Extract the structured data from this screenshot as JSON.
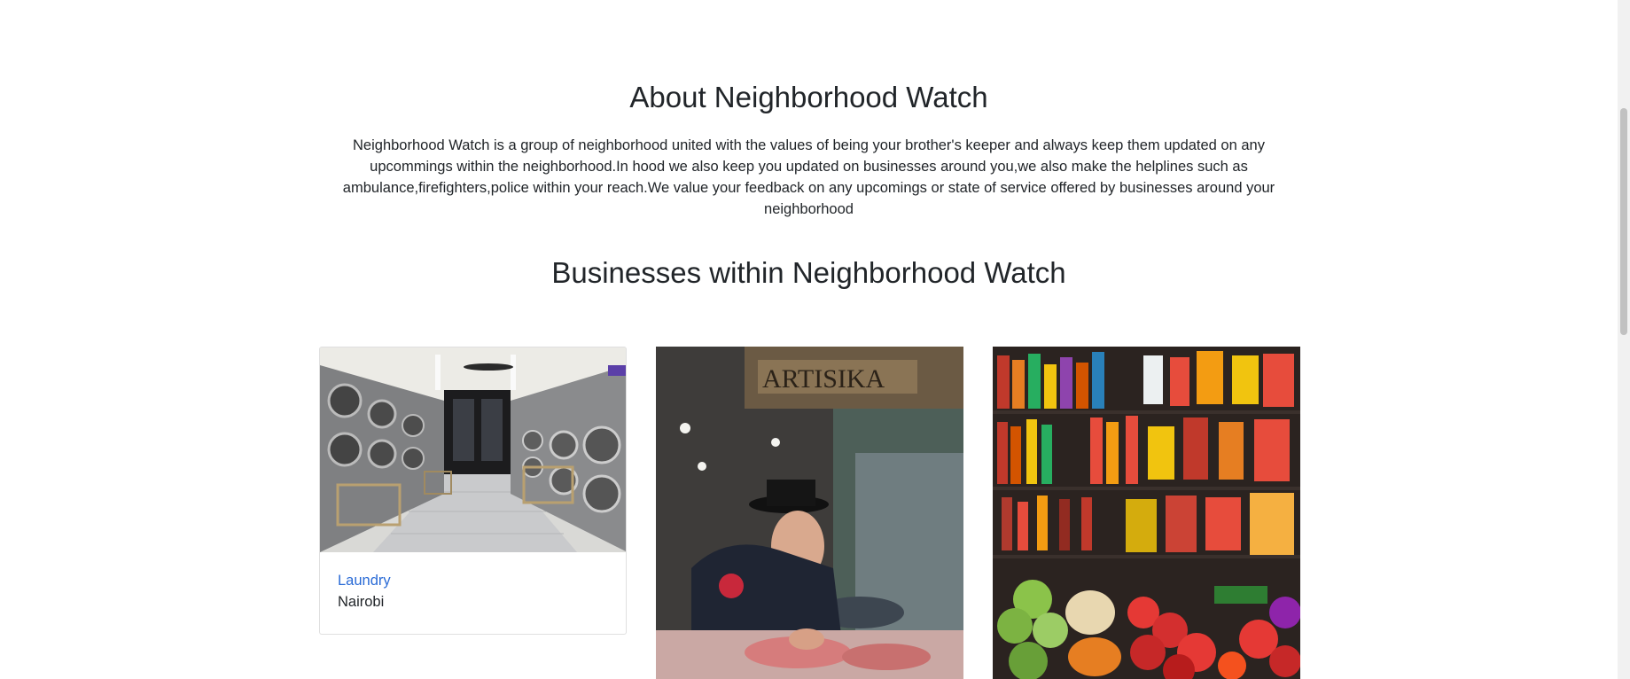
{
  "about": {
    "title": "About Neighborhood Watch",
    "text": "Neighborhood Watch is a group of neighborhood united with the values of being your brother's keeper and always keep them updated on any upcommings within the neighborhood.In hood we also keep you updated on businesses around you,we also make the helplines such as ambulance,firefighters,police within your reach.We value your feedback on any upcomings or state of service offered by businesses around your neighborhood"
  },
  "businesses": {
    "title": "Businesses within Neighborhood Watch",
    "cards": [
      {
        "name": "Laundry",
        "location": "Nairobi",
        "image_icon": "laundromat-photo"
      },
      {
        "name": "",
        "location": "",
        "image_icon": "butcher-photo"
      },
      {
        "name": "",
        "location": "",
        "image_icon": "market-stall-photo"
      }
    ]
  },
  "colors": {
    "link": "#2a6bd6",
    "text": "#212529",
    "border": "#dfdfdf"
  }
}
